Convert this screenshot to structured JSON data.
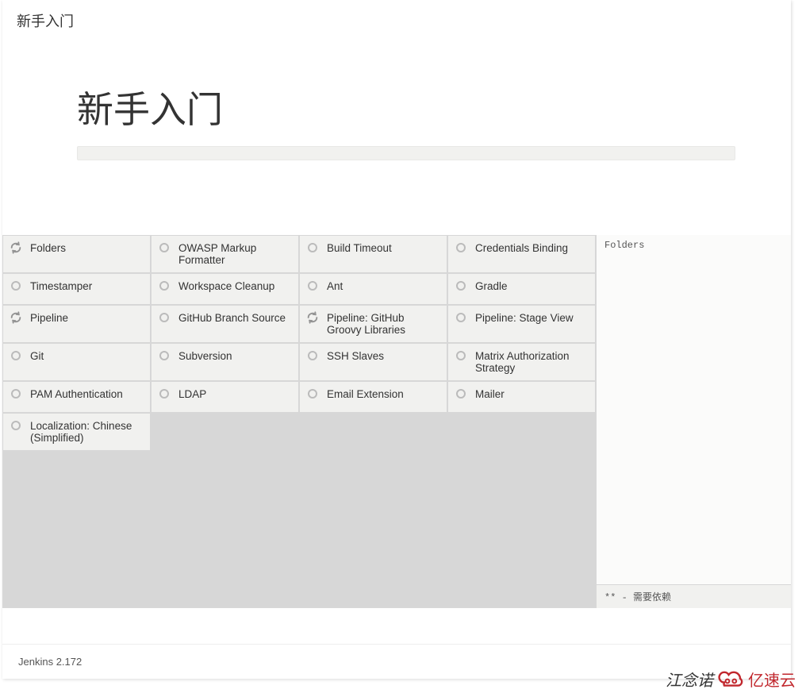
{
  "header": {
    "title": "新手入门"
  },
  "hero": {
    "title": "新手入门"
  },
  "side": {
    "current": "Folders",
    "legend_marker": "**",
    "legend_sep": " - ",
    "legend_text": "需要依赖"
  },
  "footer": {
    "version": "Jenkins 2.172"
  },
  "watermark": {
    "t1": "江念诺",
    "t2": "亿速云"
  },
  "plugins": [
    {
      "label": "Folders",
      "status": "loading"
    },
    {
      "label": "OWASP Markup Formatter",
      "status": "pending"
    },
    {
      "label": "Build Timeout",
      "status": "pending"
    },
    {
      "label": "Credentials Binding",
      "status": "pending"
    },
    {
      "label": "Timestamper",
      "status": "pending"
    },
    {
      "label": "Workspace Cleanup",
      "status": "pending"
    },
    {
      "label": "Ant",
      "status": "pending"
    },
    {
      "label": "Gradle",
      "status": "pending"
    },
    {
      "label": "Pipeline",
      "status": "loading"
    },
    {
      "label": "GitHub Branch Source",
      "status": "pending"
    },
    {
      "label": "Pipeline: GitHub Groovy Libraries",
      "status": "loading"
    },
    {
      "label": "Pipeline: Stage View",
      "status": "pending"
    },
    {
      "label": "Git",
      "status": "pending"
    },
    {
      "label": "Subversion",
      "status": "pending"
    },
    {
      "label": "SSH Slaves",
      "status": "pending"
    },
    {
      "label": "Matrix Authorization Strategy",
      "status": "pending"
    },
    {
      "label": "PAM Authentication",
      "status": "pending"
    },
    {
      "label": "LDAP",
      "status": "pending"
    },
    {
      "label": "Email Extension",
      "status": "pending"
    },
    {
      "label": "Mailer",
      "status": "pending"
    },
    {
      "label": "Localization: Chinese (Simplified)",
      "status": "pending"
    }
  ]
}
